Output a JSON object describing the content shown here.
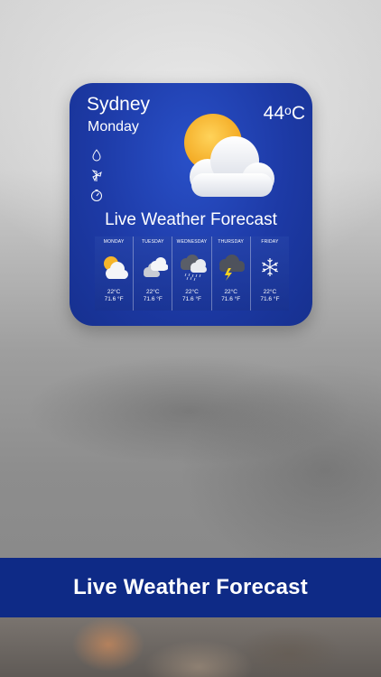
{
  "widget": {
    "city": "Sydney",
    "day": "Monday",
    "temperature": "44",
    "temperature_unit": "C",
    "headline": "Live Weather Forecast",
    "side_icons": [
      "droplet-icon",
      "wind-icon",
      "gauge-icon"
    ],
    "current_condition_icon": "sun-behind-cloud-icon",
    "forecast": [
      {
        "day": "MONDAY",
        "icon": "partly-sunny-icon",
        "celsius": "22°C",
        "fahrenheit": "71.6 °F"
      },
      {
        "day": "TUESDAY",
        "icon": "cloudy-icon",
        "celsius": "22°C",
        "fahrenheit": "71.6 °F"
      },
      {
        "day": "WEDNESDAY",
        "icon": "rain-icon",
        "celsius": "22°C",
        "fahrenheit": "71.6 °F"
      },
      {
        "day": "THURSDAY",
        "icon": "thunderstorm-icon",
        "celsius": "22°C",
        "fahrenheit": "71.6 °F"
      },
      {
        "day": "FRIDAY",
        "icon": "snowflake-icon",
        "celsius": "22°C",
        "fahrenheit": "71.6 °F"
      }
    ]
  },
  "banner": {
    "title": "Live Weather Forecast"
  },
  "colors": {
    "widget_blue": "#1d3aa6",
    "banner_navy": "#0e2a86",
    "sun": "#f6b52a"
  }
}
